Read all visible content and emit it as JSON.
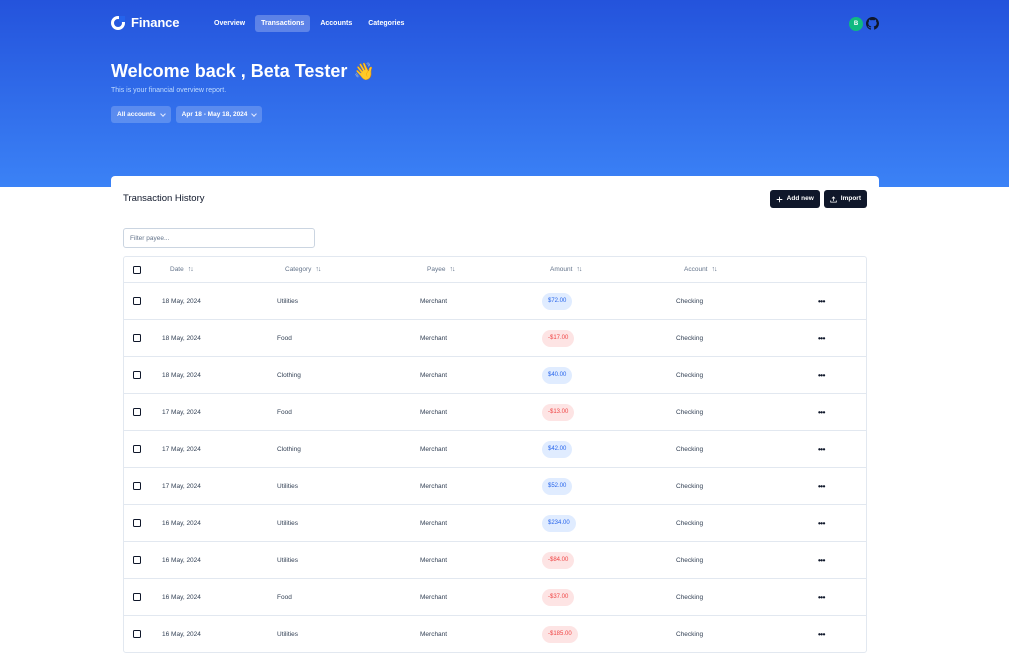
{
  "brand": {
    "name": "Finance"
  },
  "nav": {
    "items": [
      {
        "label": "Overview",
        "active": false
      },
      {
        "label": "Transactions",
        "active": true
      },
      {
        "label": "Accounts",
        "active": false
      },
      {
        "label": "Categories",
        "active": false
      }
    ]
  },
  "user": {
    "initial": "B"
  },
  "hero": {
    "welcome": "Welcome back , Beta Tester",
    "wave_emoji": "👋",
    "subtitle": "This is your financial overview report.",
    "account_filter": "All accounts",
    "date_filter": "Apr 18 - May 18, 2024"
  },
  "card": {
    "title": "Transaction History",
    "add_label": "Add new",
    "import_label": "Import",
    "filter_placeholder": "Filter payee..."
  },
  "table": {
    "columns": {
      "date": "Date",
      "category": "Category",
      "payee": "Payee",
      "amount": "Amount",
      "account": "Account"
    },
    "rows": [
      {
        "date": "18 May, 2024",
        "category": "Utilities",
        "payee": "Merchant",
        "amount": "$72.00",
        "positive": true,
        "account": "Checking"
      },
      {
        "date": "18 May, 2024",
        "category": "Food",
        "payee": "Merchant",
        "amount": "-$17.00",
        "positive": false,
        "account": "Checking"
      },
      {
        "date": "18 May, 2024",
        "category": "Clothing",
        "payee": "Merchant",
        "amount": "$40.00",
        "positive": true,
        "account": "Checking"
      },
      {
        "date": "17 May, 2024",
        "category": "Food",
        "payee": "Merchant",
        "amount": "-$13.00",
        "positive": false,
        "account": "Checking"
      },
      {
        "date": "17 May, 2024",
        "category": "Clothing",
        "payee": "Merchant",
        "amount": "$42.00",
        "positive": true,
        "account": "Checking"
      },
      {
        "date": "17 May, 2024",
        "category": "Utilities",
        "payee": "Merchant",
        "amount": "$52.00",
        "positive": true,
        "account": "Checking"
      },
      {
        "date": "16 May, 2024",
        "category": "Utilities",
        "payee": "Merchant",
        "amount": "$234.00",
        "positive": true,
        "account": "Checking"
      },
      {
        "date": "16 May, 2024",
        "category": "Utilities",
        "payee": "Merchant",
        "amount": "-$84.00",
        "positive": false,
        "account": "Checking"
      },
      {
        "date": "16 May, 2024",
        "category": "Food",
        "payee": "Merchant",
        "amount": "-$37.00",
        "positive": false,
        "account": "Checking"
      },
      {
        "date": "16 May, 2024",
        "category": "Utilities",
        "payee": "Merchant",
        "amount": "-$185.00",
        "positive": false,
        "account": "Checking"
      }
    ]
  },
  "colors": {
    "hero_top": "#2453dc",
    "hero_bottom": "#3b82f6",
    "positive": "#2563eb",
    "negative": "#ef4444",
    "button_dark": "#0f172a",
    "avatar": "#10b981"
  },
  "icons": {
    "brand": "finance-logo-icon",
    "github": "github-icon",
    "add": "plus-icon",
    "import": "upload-icon",
    "row_menu": "more-horizontal-icon",
    "sort": "sort-arrows-icon"
  }
}
